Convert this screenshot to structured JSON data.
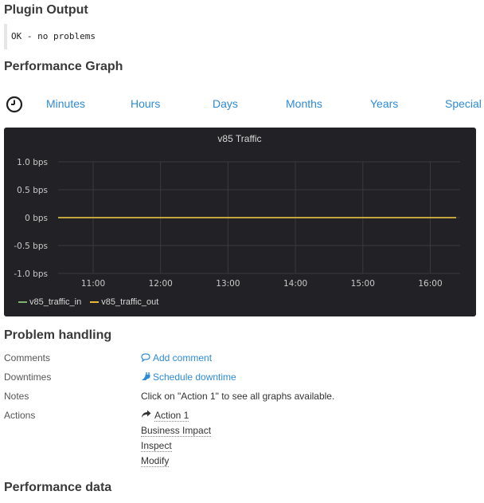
{
  "plugin_output": {
    "heading": "Plugin Output",
    "text": "OK - no problems"
  },
  "performance_graph": {
    "heading": "Performance Graph",
    "timeframes": [
      "Minutes",
      "Hours",
      "Days",
      "Months",
      "Years",
      "Special"
    ]
  },
  "chart_data": {
    "type": "line",
    "title": "v85 Traffic",
    "x_ticks": [
      "11:00",
      "12:00",
      "13:00",
      "14:00",
      "15:00",
      "16:00"
    ],
    "y_ticks": [
      "1.0 bps",
      "0.5 bps",
      "0 bps",
      "-0.5 bps",
      "-1.0 bps"
    ],
    "ylim": [
      -1.0,
      1.0
    ],
    "grid": true,
    "legend_position": "bottom-left",
    "series": [
      {
        "name": "v85_traffic_in",
        "color": "#7eb26d",
        "values": [
          0,
          0,
          0,
          0,
          0,
          0
        ]
      },
      {
        "name": "v85_traffic_out",
        "color": "#eab839",
        "values": [
          0,
          0,
          0,
          0,
          0,
          0
        ]
      }
    ]
  },
  "problem_handling": {
    "heading": "Problem handling",
    "comments_label": "Comments",
    "comments_link": "Add comment",
    "downtimes_label": "Downtimes",
    "downtimes_link": "Schedule downtime",
    "notes_label": "Notes",
    "notes_text": "Click on \"Action 1\" to see all graphs available.",
    "actions_label": "Actions",
    "actions": [
      "Action 1",
      "Business Impact",
      "Inspect",
      "Modify"
    ]
  },
  "performance_data": {
    "heading": "Performance data"
  },
  "colors": {
    "link": "#2f8bd6",
    "graph_bg": "#222226",
    "grid": "#3a3a3e"
  }
}
